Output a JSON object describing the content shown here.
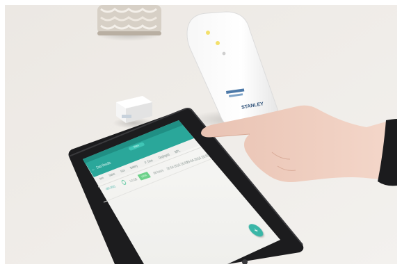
{
  "photo": {
    "description_free": true
  },
  "device": {
    "brand_logo_text": "STANLEY"
  },
  "tablet_app": {
    "back_glyph": "←",
    "title": "Data Results",
    "pill_label": "Status",
    "columns": [
      "Item",
      "Status",
      "Size",
      "Battery",
      "P. Time",
      "Deployed",
      "BPL"
    ],
    "row": {
      "id": "ABC-0001",
      "cells": [
        "Active",
        "1.0 GB",
        "100%",
        "08 hours",
        "28-04-2016 16:00",
        "29-04-2016 10:00"
      ]
    },
    "fab_glyph": "+"
  },
  "colors": {
    "table_top": "#efebe6",
    "appbar": "#2aa79a",
    "screen_bg": "#f6f6f4",
    "tablet_bezel": "#1c1c1e",
    "accent": "#39b6a7"
  }
}
